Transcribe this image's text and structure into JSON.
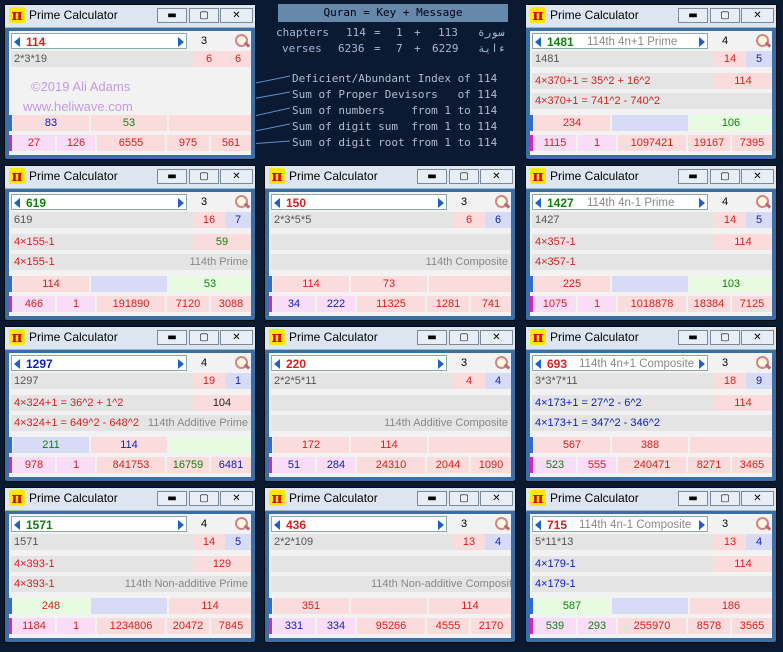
{
  "app_title": "Prime Calculator",
  "controls": {
    "min": "▬",
    "max": "▢",
    "close": "✕"
  },
  "colors": {
    "desktop": "#0b1a30",
    "frame": "#3a6ea5",
    "red": "#d82020",
    "green": "#108010",
    "blue": "#1020c0"
  },
  "center": {
    "header": "Quran = Key + Message",
    "chapters_label": "chapters",
    "chapters_val": "114",
    "eq1": "=",
    "chap_a": "1",
    "plus1": "+",
    "chap_b": "113",
    "chap_ar": "سورة",
    "verses_label": "verses",
    "verses_val": "6236",
    "eq2": "=",
    "ver_a": "7",
    "plus2": "+",
    "ver_b": "6229",
    "ver_ar": "ءاية",
    "lines": [
      {
        "text": "Deficient/Abundant Index of 114",
        "dim": "Deficient"
      },
      {
        "text": "Sum of Proper Devisors   of 114"
      },
      {
        "text": "Sum of numbers    from 1 to 114"
      },
      {
        "text": "Sum of digit sum  from 1 to 114"
      },
      {
        "text": "Sum of digit root from 1 to 114"
      }
    ]
  },
  "windows": [
    {
      "num": "114",
      "numc": "red",
      "digits": "3",
      "sub": "",
      "r1": [
        "2*3*19",
        "6",
        "6"
      ],
      "r1c": [
        "gray",
        "rc",
        "rc"
      ],
      "credit1": "©2019 Ali Adams",
      "credit2": "www.heliwave.com",
      "r4": [
        "83",
        "53",
        ""
      ],
      "r5": [
        "27",
        "126",
        "6555",
        "975",
        "561"
      ]
    },
    {
      "num": "1481",
      "numc": "green",
      "digits": "4",
      "sub": "114th 4n+1 Prime",
      "r1": [
        "1481",
        "14",
        "5"
      ],
      "r2": "4×370+1 = 35^2 + 16^2",
      "r2v": "114",
      "r3": "4×370+1 = 741^2 - 740^2",
      "r3v": "",
      "r4": [
        "234",
        "",
        "106"
      ],
      "r5": [
        "1115",
        "1",
        "1097421",
        "19167",
        "7395"
      ]
    },
    {
      "num": "619",
      "numc": "green",
      "digits": "3",
      "sub": "",
      "r1": [
        "619",
        "16",
        "7"
      ],
      "r2": "4×155-1",
      "r2v": "59",
      "r3": "4×155-1",
      "r3v": "114th Prime",
      "r4": [
        "114",
        "",
        "53"
      ],
      "r5": [
        "466",
        "1",
        "191890",
        "7120",
        "3088"
      ]
    },
    {
      "num": "150",
      "numc": "red",
      "digits": "3",
      "sub": "",
      "r1": [
        "2*3*5*5",
        "6",
        "6"
      ],
      "r2": "",
      "r2v": "",
      "r3": "",
      "r3v": "114th Composite",
      "r4": [
        "114",
        "73",
        ""
      ],
      "r5": [
        "34",
        "222",
        "11325",
        "1281",
        "741"
      ]
    },
    {
      "num": "1427",
      "numc": "green",
      "digits": "4",
      "sub": "114th 4n-1 Prime",
      "r1": [
        "1427",
        "14",
        "5"
      ],
      "r2": "4×357-1",
      "r2v": "114",
      "r3": "4×357-1",
      "r3v": "",
      "r4": [
        "225",
        "",
        "103"
      ],
      "r5": [
        "1075",
        "1",
        "1018878",
        "18384",
        "7125"
      ]
    },
    {
      "num": "1297",
      "numc": "blue",
      "digits": "4",
      "sub": "",
      "r1": [
        "1297",
        "19",
        "1"
      ],
      "r2": "4×324+1 = 36^2 + 1^2",
      "r2v": "104",
      "r3": "4×324+1 = 649^2 - 648^2",
      "r3v": "114th Additive Prime",
      "r4": [
        "211",
        "114",
        ""
      ],
      "r5": [
        "978",
        "1",
        "841753",
        "16759",
        "6481"
      ]
    },
    {
      "num": "220",
      "numc": "red",
      "digits": "3",
      "sub": "",
      "r1": [
        "2*2*5*11",
        "4",
        "4"
      ],
      "r2": "",
      "r2v": "",
      "r3": "",
      "r3v": "114th Additive Composite",
      "r4": [
        "172",
        "114",
        ""
      ],
      "r5": [
        "51",
        "284",
        "24310",
        "2044",
        "1090"
      ]
    },
    {
      "num": "693",
      "numc": "red",
      "digits": "3",
      "sub": "114th 4n+1 Composite",
      "r1": [
        "3*3*7*11",
        "18",
        "9"
      ],
      "r2": "4×173+1 = 27^2 - 6^2",
      "r2v": "114",
      "r3": "4×173+1 = 347^2 - 346^2",
      "r3v": "",
      "r4": [
        "567",
        "388",
        ""
      ],
      "r5": [
        "523",
        "555",
        "240471",
        "8271",
        "3465"
      ]
    },
    {
      "num": "1571",
      "numc": "green",
      "digits": "4",
      "sub": "",
      "r1": [
        "1571",
        "14",
        "5"
      ],
      "r2": "4×393-1",
      "r2v": "129",
      "r3": "4×393-1",
      "r3v": "114th Non-additive Prime",
      "r4": [
        "248",
        "",
        "114"
      ],
      "r5": [
        "1184",
        "1",
        "1234806",
        "20472",
        "7845"
      ]
    },
    {
      "num": "436",
      "numc": "red",
      "digits": "3",
      "sub": "",
      "r1": [
        "2*2*109",
        "13",
        "4"
      ],
      "r2": "",
      "r2v": "",
      "r3": "",
      "r3v": "114th Non-additive Composite",
      "r4": [
        "351",
        "",
        "114"
      ],
      "r5": [
        "331",
        "334",
        "95266",
        "4555",
        "2170"
      ]
    },
    {
      "num": "715",
      "numc": "red",
      "digits": "3",
      "sub": "114th 4n-1 Composite",
      "r1": [
        "5*11*13",
        "13",
        "4"
      ],
      "r2": "4×179-1",
      "r2v": "114",
      "r3": "4×179-1",
      "r3v": "",
      "r4": [
        "587",
        "",
        "186"
      ],
      "r5": [
        "539",
        "293",
        "255970",
        "8578",
        "3565"
      ]
    }
  ]
}
